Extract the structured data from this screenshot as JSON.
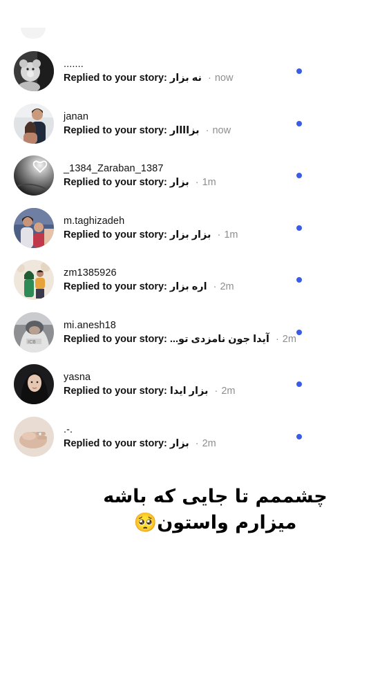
{
  "reply_prefix": "Replied to your story:",
  "separator": "·",
  "accent": "#3b5ce6",
  "rows": [
    {
      "name": ".......",
      "message": "نه بزار",
      "time": "now",
      "avatar": "teddy-bear-photo"
    },
    {
      "name": "janan",
      "message": "بزاااار",
      "time": "now",
      "avatar": "couple-photo"
    },
    {
      "name": "_1384_Zaraban_1387",
      "message": "بزار",
      "time": "1m",
      "avatar": "heart-shape-dark"
    },
    {
      "name": "m.taghizadeh",
      "message": "بزار بزار",
      "time": "1m",
      "avatar": "couple-photo"
    },
    {
      "name": "zm1385926",
      "message": "اره بزار",
      "time": "2m",
      "avatar": "couple-photo-outdoor"
    },
    {
      "name": "mi.anesh18",
      "message": "آیدا جون نامزدی تو...",
      "time": "2m",
      "avatar": "person-in-hood"
    },
    {
      "name": "yasna",
      "message": "بزار ایدا",
      "time": "2m",
      "avatar": "woman-portrait"
    },
    {
      "name": ".-.",
      "message": "بزار",
      "time": "2m",
      "avatar": "hands-photo"
    }
  ],
  "caption": {
    "line1": "چشممم تا جایی که باشه",
    "line2": "میزارم واستون🥺"
  }
}
